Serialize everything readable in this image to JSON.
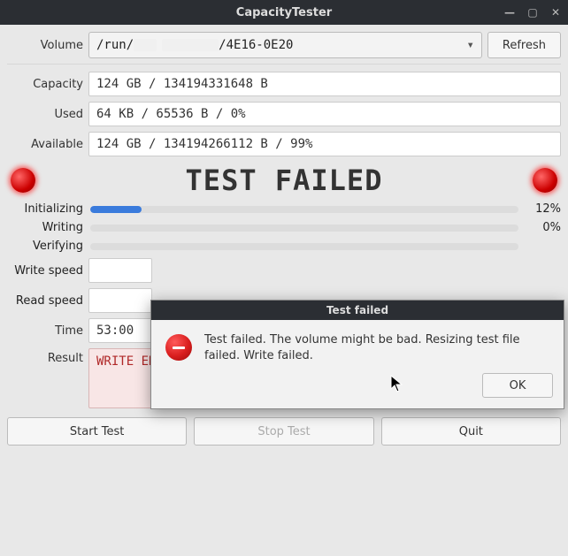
{
  "window": {
    "title": "CapacityTester"
  },
  "form": {
    "volume_label": "Volume",
    "volume_value_prefix": "/run/",
    "volume_value_suffix": "/4E16-0E20",
    "refresh_label": "Refresh",
    "capacity_label": "Capacity",
    "capacity_value": "124 GB / 134194331648 B",
    "used_label": "Used",
    "used_value": "64 KB / 65536 B / 0%",
    "available_label": "Available",
    "available_value": "124 GB / 134194266112 B / 99%"
  },
  "status": {
    "text": "TEST FAILED"
  },
  "progress": {
    "init_label": "Initializing",
    "init_pct": "12%",
    "init_width": "12%",
    "write_label": "Writing",
    "write_pct": "0%",
    "write_width": "0%",
    "verify_label": "Verifying"
  },
  "speed": {
    "write_label": "Write speed",
    "write_value": "",
    "read_label": "Read speed",
    "read_value": ""
  },
  "time": {
    "label": "Time",
    "value": "53:00"
  },
  "result": {
    "label": "Result",
    "value": "WRITE ERROR AFTER 16288 MB!"
  },
  "buttons": {
    "start": "Start Test",
    "stop": "Stop Test",
    "quit": "Quit"
  },
  "dialog": {
    "title": "Test failed",
    "message": "Test failed. The volume might be bad. Resizing test file failed. Write failed.",
    "ok": "OK"
  }
}
